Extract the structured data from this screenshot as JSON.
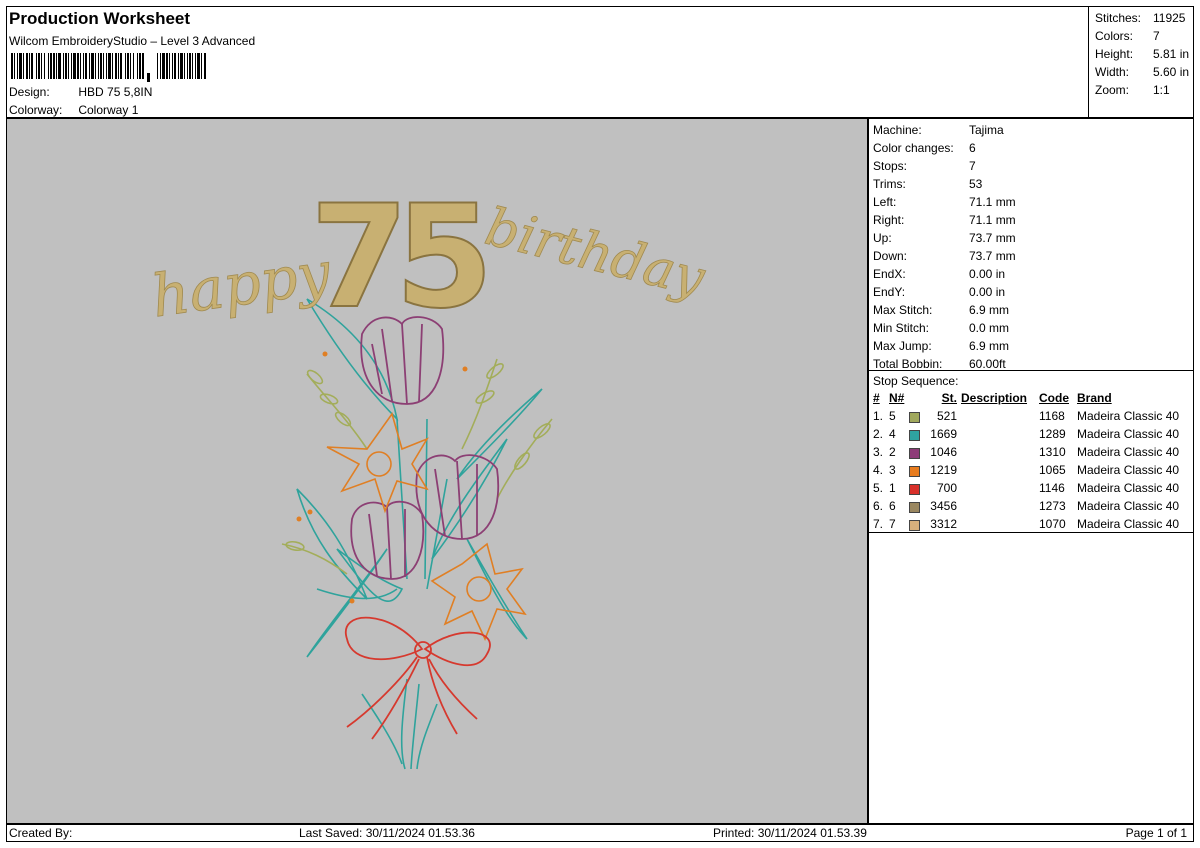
{
  "header": {
    "title": "Production Worksheet",
    "subtitle": "Wilcom EmbroideryStudio – Level 3 Advanced",
    "barcode_icon": "barcode-icon",
    "design_label": "Design:",
    "design_value": "HBD 75 5,8IN",
    "colorway_label": "Colorway:",
    "colorway_value": "Colorway 1"
  },
  "summary": [
    {
      "label": "Stitches:",
      "value": "11925"
    },
    {
      "label": "Colors:",
      "value": "7"
    },
    {
      "label": "Height:",
      "value": "5.81 in"
    },
    {
      "label": "Width:",
      "value": "5.60 in"
    },
    {
      "label": "Zoom:",
      "value": "1:1"
    }
  ],
  "preview": {
    "word_left": "happy",
    "number": "75",
    "word_right": "birthday",
    "thread_colors": {
      "gold": "#c8b072",
      "gold_dark": "#8a7440",
      "teal": "#2fa39c",
      "plum": "#8c3f74",
      "orange": "#e07f24",
      "red": "#d6392e",
      "olive": "#a3ad5a"
    }
  },
  "machine": [
    {
      "label": "Machine:",
      "value": "Tajima"
    },
    {
      "label": "Color changes:",
      "value": "6"
    },
    {
      "label": "Stops:",
      "value": "7"
    },
    {
      "label": "Trims:",
      "value": "53"
    },
    {
      "label": "Left:",
      "value": "71.1 mm"
    },
    {
      "label": "Right:",
      "value": "71.1 mm"
    },
    {
      "label": "Up:",
      "value": "73.7 mm"
    },
    {
      "label": "Down:",
      "value": "73.7 mm"
    },
    {
      "label": "EndX:",
      "value": "0.00 in"
    },
    {
      "label": "EndY:",
      "value": "0.00 in"
    },
    {
      "label": "Max Stitch:",
      "value": "6.9 mm"
    },
    {
      "label": "Min Stitch:",
      "value": "0.0 mm"
    },
    {
      "label": "Max Jump:",
      "value": "6.9 mm"
    },
    {
      "label": "Total Bobbin:",
      "value": "60.00ft"
    }
  ],
  "stops": {
    "caption": "Stop Sequence:",
    "headers": {
      "num": "#",
      "n": "N#",
      "st": "St.",
      "desc": "Description",
      "code": "Code",
      "brand": "Brand"
    },
    "rows": [
      {
        "num": "1.",
        "n": "5",
        "color": "#a0a85c",
        "st": "521",
        "desc": "",
        "code": "1168",
        "brand": "Madeira Classic 40"
      },
      {
        "num": "2.",
        "n": "4",
        "color": "#2fa3a0",
        "st": "1669",
        "desc": "",
        "code": "1289",
        "brand": "Madeira Classic 40"
      },
      {
        "num": "3.",
        "n": "2",
        "color": "#8e3c78",
        "st": "1046",
        "desc": "",
        "code": "1310",
        "brand": "Madeira Classic 40"
      },
      {
        "num": "4.",
        "n": "3",
        "color": "#e87c1e",
        "st": "1219",
        "desc": "",
        "code": "1065",
        "brand": "Madeira Classic 40"
      },
      {
        "num": "5.",
        "n": "1",
        "color": "#d8302a",
        "st": "700",
        "desc": "",
        "code": "1146",
        "brand": "Madeira Classic 40"
      },
      {
        "num": "6.",
        "n": "6",
        "color": "#9a8760",
        "st": "3456",
        "desc": "",
        "code": "1273",
        "brand": "Madeira Classic 40"
      },
      {
        "num": "7.",
        "n": "7",
        "color": "#d8b07c",
        "st": "3312",
        "desc": "",
        "code": "1070",
        "brand": "Madeira Classic 40"
      }
    ]
  },
  "footer": {
    "created_by": "Created By:",
    "last_saved": "Last Saved: 30/11/2024 01.53.36",
    "printed": "Printed: 30/11/2024 01.53.39",
    "page": "Page 1 of 1"
  }
}
